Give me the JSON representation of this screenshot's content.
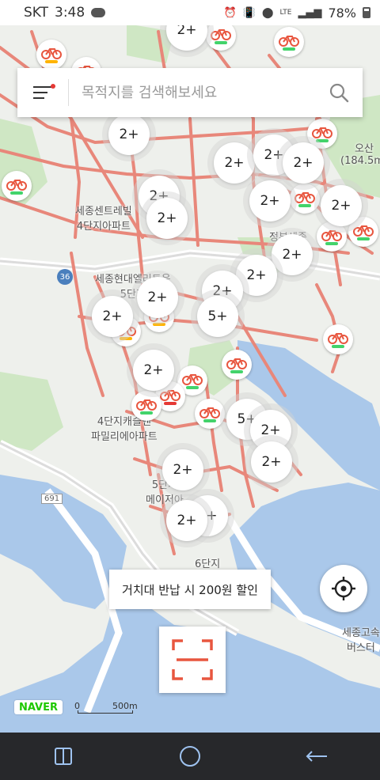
{
  "status_bar": {
    "carrier": "SKT",
    "time": "3:48",
    "network": "LTE",
    "battery": "78%"
  },
  "search": {
    "placeholder": "목적지를 검색해보세요"
  },
  "map_labels": {
    "apt_central": "세종센트레빌\n4단지아파트",
    "apt_hyundai": "세종현대엘리트운\n5단지",
    "apt_castle": "4단지캐슬앤\n파밀리에아파트",
    "apt_5danji": "5단지\n메이저아",
    "apt_6danji": "6단지",
    "osan": "오산\n(184.5m)",
    "jeongbu": "정부세종",
    "bus_terminal": "세종고속\n버스터",
    "route_36": "36",
    "road_691": "691"
  },
  "clusters": [
    {
      "label": "2+"
    },
    {
      "label": "2+"
    },
    {
      "label": "2+"
    },
    {
      "label": "2+"
    },
    {
      "label": "2+"
    },
    {
      "label": "2+"
    },
    {
      "label": "2+"
    },
    {
      "label": "2+"
    },
    {
      "label": "2+"
    },
    {
      "label": "2+"
    },
    {
      "label": "2+"
    },
    {
      "label": "2+"
    },
    {
      "label": "5+"
    },
    {
      "label": "2+"
    },
    {
      "label": "2+"
    },
    {
      "label": "2+"
    },
    {
      "label": "5+"
    },
    {
      "label": "2+"
    },
    {
      "label": "2+"
    },
    {
      "label": "2+"
    },
    {
      "label": "2+"
    },
    {
      "label": "2+"
    }
  ],
  "bike_pins": [
    {
      "battery_color": "#ffb300"
    },
    {
      "battery_color": "#43d36b"
    },
    {
      "battery_color": "#43d36b"
    },
    {
      "battery_color": "#43d36b"
    },
    {
      "battery_color": "#43d36b"
    },
    {
      "battery_color": "#43d36b"
    },
    {
      "battery_color": "#43d36b"
    },
    {
      "battery_color": "#43d36b"
    },
    {
      "battery_color": "#43d36b"
    },
    {
      "battery_color": "#ffb300"
    },
    {
      "battery_color": "#ffb300"
    },
    {
      "battery_color": "#43d36b"
    },
    {
      "battery_color": "#43d36b"
    },
    {
      "battery_color": "#e53935"
    },
    {
      "battery_color": "#43d36b"
    },
    {
      "battery_color": "#43d36b"
    },
    {
      "battery_color": "#43d36b"
    }
  ],
  "promo": {
    "text": "거치대 반납 시 200원 할인"
  },
  "map_footer": {
    "logo": "NAVER",
    "scale_start": "0",
    "scale_end": "500m"
  },
  "colors": {
    "accent": "#e8563f",
    "road": "#e8877a",
    "water": "#aac8ea",
    "park": "#cfe7c4"
  },
  "nav_bar": {
    "recent_icon": "recent-apps-icon",
    "home_icon": "home-icon",
    "back_icon": "back-icon"
  }
}
